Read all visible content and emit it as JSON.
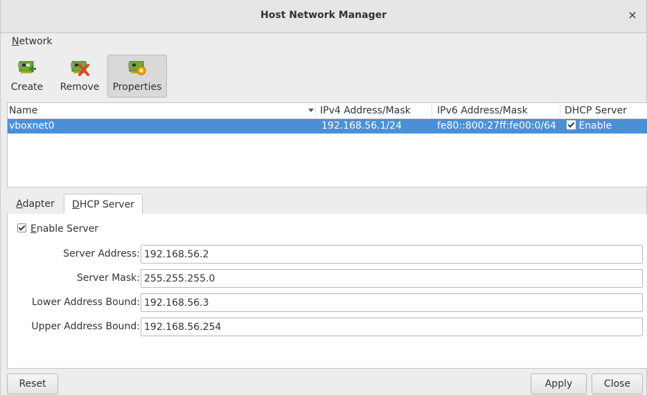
{
  "window": {
    "title": "Host Network Manager",
    "close_glyph": "×"
  },
  "menu": {
    "network": "Network",
    "network_mnemonic": "N",
    "network_rest": "etwork"
  },
  "toolbar": {
    "create": "Create",
    "remove": "Remove",
    "properties": "Properties",
    "active": "properties"
  },
  "list": {
    "columns": [
      "Name",
      "IPv4 Address/Mask",
      "IPv6 Address/Mask",
      "DHCP Server"
    ],
    "rows": [
      {
        "name": "vboxnet0",
        "ipv4": "192.168.56.1/24",
        "ipv6": "fe80::800:27ff:fe00:0/64",
        "dhcp": "Enable",
        "dhcp_checked": true,
        "selected": true
      }
    ]
  },
  "tabs": [
    {
      "label": "Adapter",
      "mnemonic": "A",
      "rest": "dapter",
      "selected": false
    },
    {
      "label": "DHCP Server",
      "mnemonic": "D",
      "rest": "HCP Server",
      "selected": true
    }
  ],
  "dhcp": {
    "enable_server": {
      "label": "Enable Server",
      "mnemonic": "E",
      "rest": "nable Server",
      "checked": true
    },
    "fields": [
      {
        "label": "Server Address:",
        "value": "192.168.56.2"
      },
      {
        "label": "Server Mask:",
        "value": "255.255.255.0"
      },
      {
        "label": "Lower Address Bound:",
        "value": "192.168.56.3"
      },
      {
        "label": "Upper Address Bound:",
        "value": "192.168.56.254"
      }
    ]
  },
  "buttons": {
    "reset": "Reset",
    "apply": "Apply",
    "close": "Close"
  },
  "colors": {
    "selection": "#4a90d9",
    "window_bg": "#ededed"
  },
  "icons": {
    "create": "network-card-add-icon",
    "remove": "network-card-remove-icon",
    "properties": "network-card-properties-icon"
  }
}
